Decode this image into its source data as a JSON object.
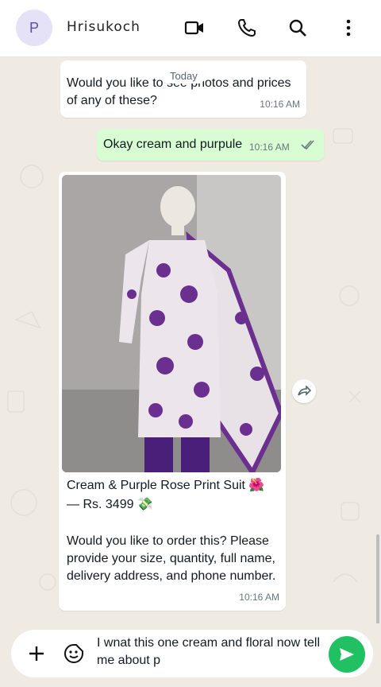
{
  "header": {
    "avatar_letter": "P",
    "contact_name": "Hrisukoch",
    "icons": [
      "video-call-icon",
      "voice-call-icon",
      "search-icon",
      "more-options-icon"
    ]
  },
  "chat": {
    "date_pill": "Today",
    "messages": [
      {
        "direction": "in",
        "text": "Would you like to see photos and prices of any of these?",
        "time": "10:16 AM"
      },
      {
        "direction": "out",
        "text": "Okay cream and purpule",
        "time": "10:16 AM",
        "status": "read"
      },
      {
        "direction": "in",
        "caption_title": "Cream & Purple Rose Print Suit 🌺",
        "caption_price": "— Rs. 3499 💸",
        "body": "Would you like to order this? Please provide your size, quantity, full name, delivery address, and phone number.",
        "time": "10:16 AM"
      }
    ]
  },
  "composer": {
    "draft_text": "I wnat this one cream and floral now tell me about p",
    "icons": [
      "plus-icon",
      "sticker-icon",
      "send-icon"
    ]
  },
  "colors": {
    "outgoing_bubble": "#d9fdd3",
    "incoming_bubble": "#ffffff",
    "send_button": "#21c063",
    "wallpaper": "#efeae2"
  }
}
